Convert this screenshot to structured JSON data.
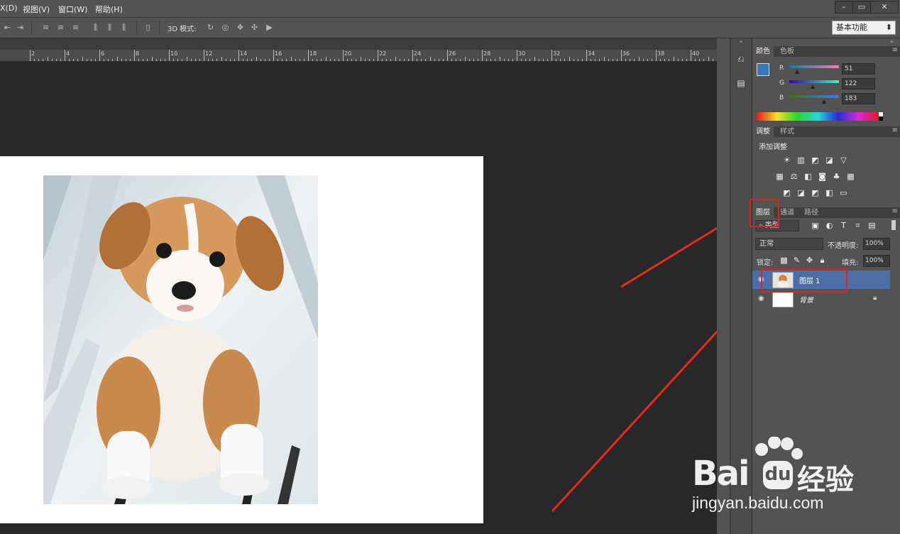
{
  "menu": {
    "items": [
      "X(D)",
      "视图(V)",
      "窗口(W)",
      "帮助(H)"
    ],
    "window_controls": {
      "minimize": "–",
      "restore": "▭",
      "close": "✕"
    }
  },
  "options_bar": {
    "mode_label": "3D 模式:",
    "workspace": "基本功能",
    "workspace_arrow": "⬍"
  },
  "ruler": {
    "labels": [
      "2",
      "4",
      "6",
      "8",
      "10",
      "12",
      "14",
      "16",
      "18",
      "20",
      "22",
      "24",
      "26",
      "28",
      "30",
      "32",
      "34",
      "36",
      "38",
      "40"
    ]
  },
  "color_panel": {
    "tabs": [
      "颜色",
      "色板"
    ],
    "channels": [
      {
        "name": "R",
        "value": "51"
      },
      {
        "name": "G",
        "value": "122"
      },
      {
        "name": "B",
        "value": "183"
      }
    ],
    "foreground_color": "#3379b7"
  },
  "adjust_panel": {
    "tabs": [
      "调整",
      "样式"
    ],
    "title": "添加调整"
  },
  "layers_panel": {
    "tabs": [
      "图层",
      "通道",
      "路径"
    ],
    "filter": "类型",
    "blend_mode": "正常",
    "opacity_label": "不透明度:",
    "opacity_value": "100%",
    "lock_label": "锁定:",
    "fill_label": "填充:",
    "fill_value": "100%",
    "layers": [
      {
        "name": "图层 1",
        "selected": true
      },
      {
        "name": "背景",
        "selected": false
      }
    ]
  },
  "watermark": {
    "brand": "Bai",
    "brand2": "经验",
    "url": "jingyan.baidu.com"
  },
  "colors": {
    "accent_red": "#e02020"
  }
}
